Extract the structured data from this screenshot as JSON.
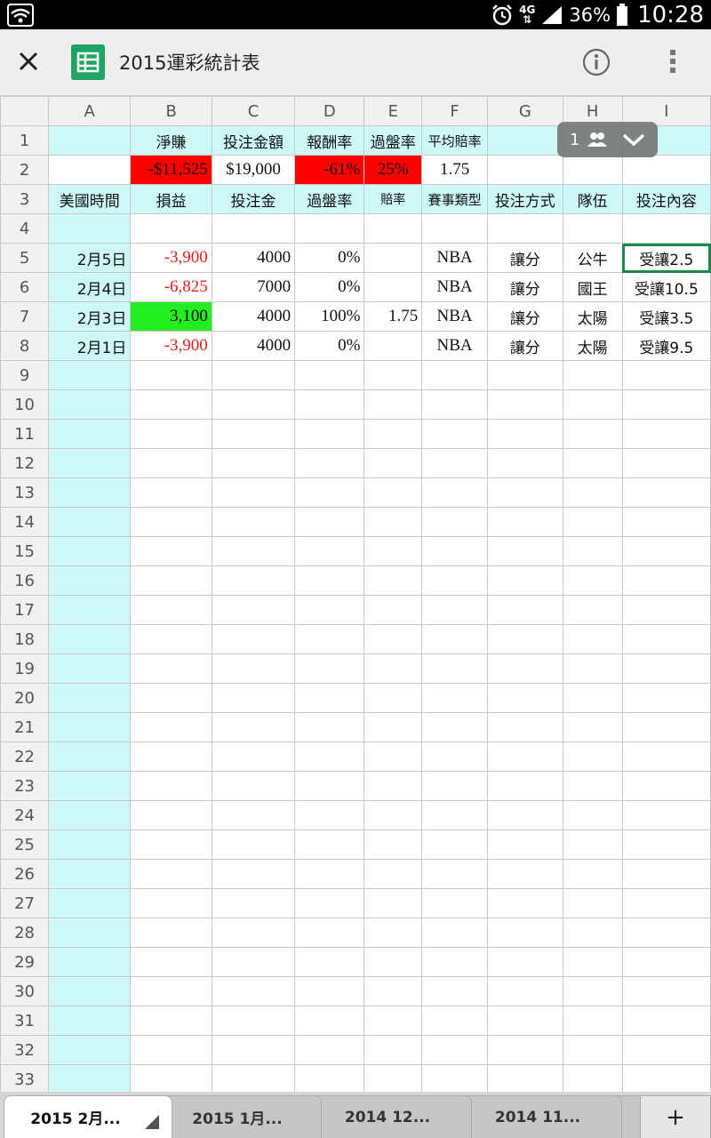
{
  "status": {
    "network": "4G",
    "battery": "36%",
    "time": "10:28"
  },
  "appbar": {
    "title": "2015運彩統計表"
  },
  "columns": [
    "A",
    "B",
    "C",
    "D",
    "E",
    "F",
    "G",
    "H",
    "I"
  ],
  "summary_headers": [
    "淨賺",
    "投注金額",
    "報酬率",
    "過盤率",
    "平均賠率"
  ],
  "summary_values": [
    "-$11,525",
    "$19,000",
    "-61%",
    "25%",
    "1.75"
  ],
  "table_headers": [
    "美國時間",
    "損益",
    "投注金",
    "過盤率",
    "賠率",
    "賽事類型",
    "投注方式",
    "隊伍",
    "投注內容"
  ],
  "rows": [
    {
      "date": "2月5日",
      "pl": "-3,900",
      "stake": "4000",
      "rate": "0%",
      "odds": "",
      "type": "NBA",
      "method": "讓分",
      "team": "公牛",
      "content": "受讓2.5"
    },
    {
      "date": "2月4日",
      "pl": "-6,825",
      "stake": "7000",
      "rate": "0%",
      "odds": "",
      "type": "NBA",
      "method": "讓分",
      "team": "國王",
      "content": "受讓10.5"
    },
    {
      "date": "2月3日",
      "pl": "3,100",
      "stake": "4000",
      "rate": "100%",
      "odds": "1.75",
      "type": "NBA",
      "method": "讓分",
      "team": "太陽",
      "content": "受讓3.5"
    },
    {
      "date": "2月1日",
      "pl": "-3,900",
      "stake": "4000",
      "rate": "0%",
      "odds": "",
      "type": "NBA",
      "method": "讓分",
      "team": "太陽",
      "content": "受讓9.5"
    }
  ],
  "collaborators": {
    "count": "1"
  },
  "tabs": [
    "2015 2月...",
    "2015 1月...",
    "2014 12...",
    "2014 11..."
  ],
  "add_tab_label": "+",
  "colors": {
    "accent": "#1e8a4a",
    "cyan": "#ccf8f8",
    "loss_bg": "#ff0000",
    "win_bg": "#22ee22",
    "loss_text": "#e02020"
  }
}
